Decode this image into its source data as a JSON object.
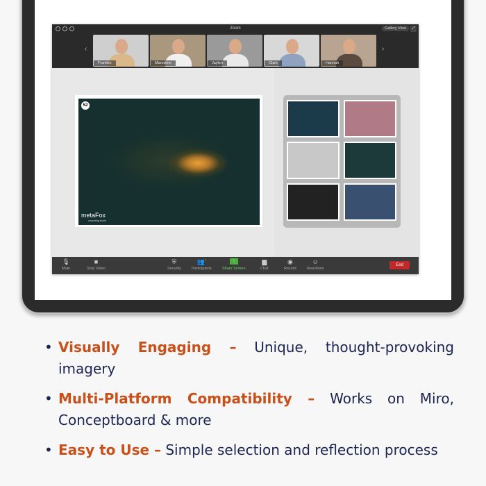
{
  "window": {
    "title": "Zoom",
    "gallery_view": "Gallery View"
  },
  "participants": [
    {
      "name": "Franklin",
      "bg": "#cfcfcf",
      "shirt": "#d9b98a"
    },
    {
      "name": "Marceline",
      "bg": "#a9977e",
      "shirt": "#f0f0f0"
    },
    {
      "name": "Jaylen",
      "bg": "#9a9a9a",
      "shirt": "#e9e9e9"
    },
    {
      "name": "Clark",
      "bg": "#d8d8d8",
      "shirt": "#8fa3c0"
    },
    {
      "name": "Hannah",
      "bg": "#b8a490",
      "shirt": "#5a4a40"
    }
  ],
  "main_card": {
    "number": "52",
    "logo": "metaFox",
    "logo_sub": "coaching tools"
  },
  "thumbnails": [
    "#1b3b4a",
    "#b07a86",
    "#c8c8c8",
    "#1c3a3a",
    "#222222",
    "#3a5070"
  ],
  "toolbar": {
    "mute": "Mute",
    "stop_video": "Stop Video",
    "security": "Security",
    "participants": "Participants",
    "participants_count": "7",
    "share_screen": "Share Screen",
    "chat": "Chat",
    "record": "Record",
    "reactions": "Reactions",
    "end": "End"
  },
  "bullets": [
    {
      "title": "Visually Engaging –",
      "text": " Unique, thought-provoking imagery"
    },
    {
      "title": "Multi-Platform Compatibility –",
      "text": " Works on Miro, Conceptboard & more"
    },
    {
      "title": "Easy to Use –",
      "text": " Simple selection and reflection process"
    }
  ],
  "colors": {
    "accent": "#c8501a",
    "text": "#1c2452",
    "end": "#c0282a",
    "share": "#4caf3e"
  }
}
